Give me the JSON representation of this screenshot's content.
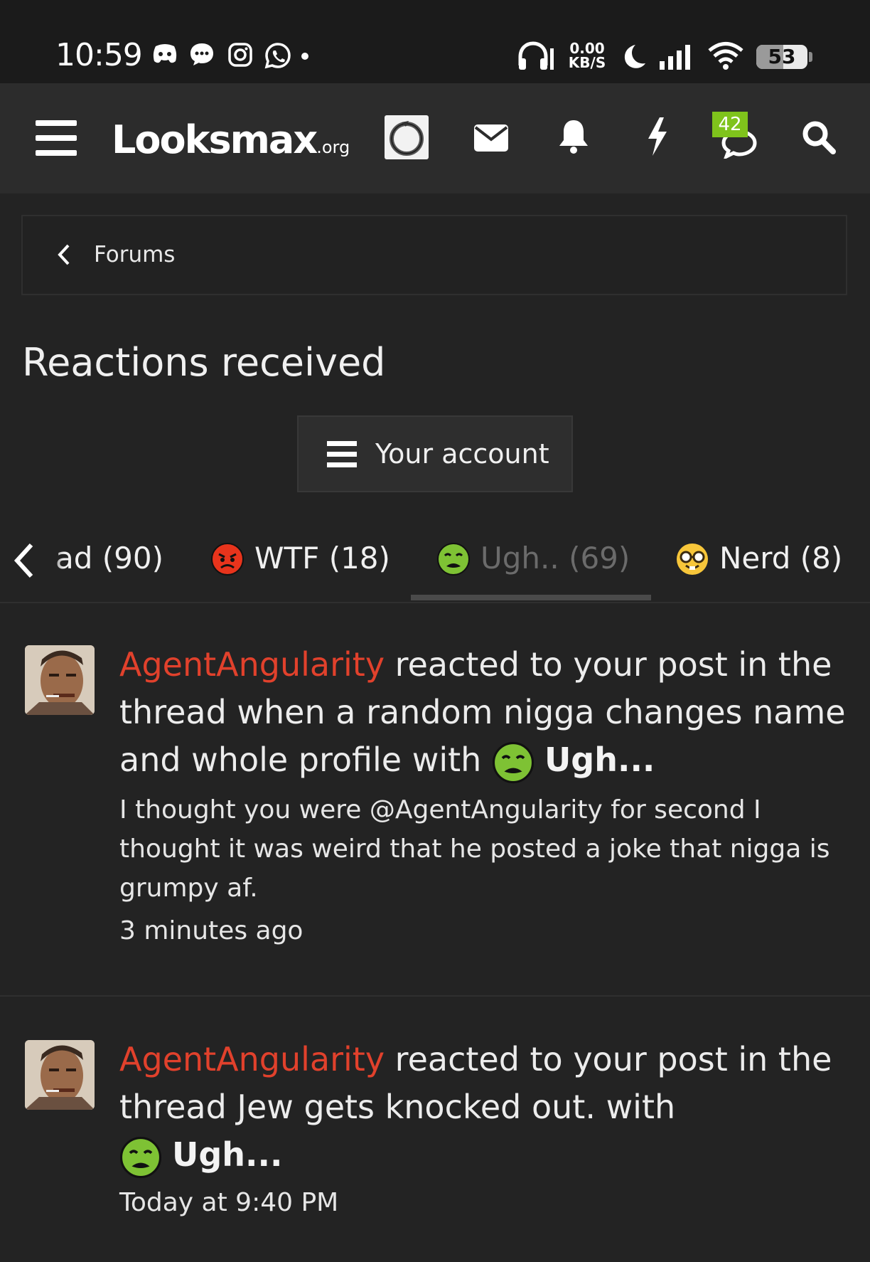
{
  "status_bar": {
    "time": "10:59",
    "net_speed": "0.00",
    "net_unit": "KB/S",
    "battery": "53",
    "battery_level": 0.53,
    "icons": [
      "discord-icon",
      "chat-bubble-icon",
      "instagram-icon",
      "whatsapp-icon",
      "dot-icon",
      "headphones-icon",
      "moon-icon",
      "signal-icon",
      "wifi-icon"
    ]
  },
  "navbar": {
    "logo_main": "Looksmax",
    "logo_suffix": ".org",
    "alerts_badge": "42",
    "icons": [
      "menu-icon",
      "avatar-icon",
      "mail-icon",
      "bell-icon",
      "bolt-icon",
      "chat-icon",
      "search-icon"
    ]
  },
  "breadcrumb": {
    "label": "Forums"
  },
  "page": {
    "title": "Reactions received",
    "account_button": "Your account"
  },
  "tabs": [
    {
      "label": "ad (90)",
      "emoji": ""
    },
    {
      "label": "WTF (18)",
      "emoji": "angry-face-icon"
    },
    {
      "label": "Ugh.. (69)",
      "emoji": "nauseated-face-icon",
      "active": true
    },
    {
      "label": "Nerd (8)",
      "emoji": "nerd-face-icon"
    }
  ],
  "items": [
    {
      "user": "AgentAngularity",
      "action": " reacted to your post in the thread when a random nigga changes name and whole profile with ",
      "reaction": "Ugh...",
      "snippet": "I thought you were @AgentAngularity for second I thought it was weird that he posted a joke that nigga is grumpy af.",
      "time": "3 minutes ago"
    },
    {
      "user": "AgentAngularity",
      "action": " reacted to your post in the thread Jew gets knocked out. with",
      "reaction": "Ugh...",
      "snippet": "",
      "time": "Today at 9:40 PM"
    }
  ],
  "colors": {
    "background": "#232323",
    "navbar": "#2c2c2c",
    "username": "#e1412c",
    "badge": "#7fc31c"
  }
}
